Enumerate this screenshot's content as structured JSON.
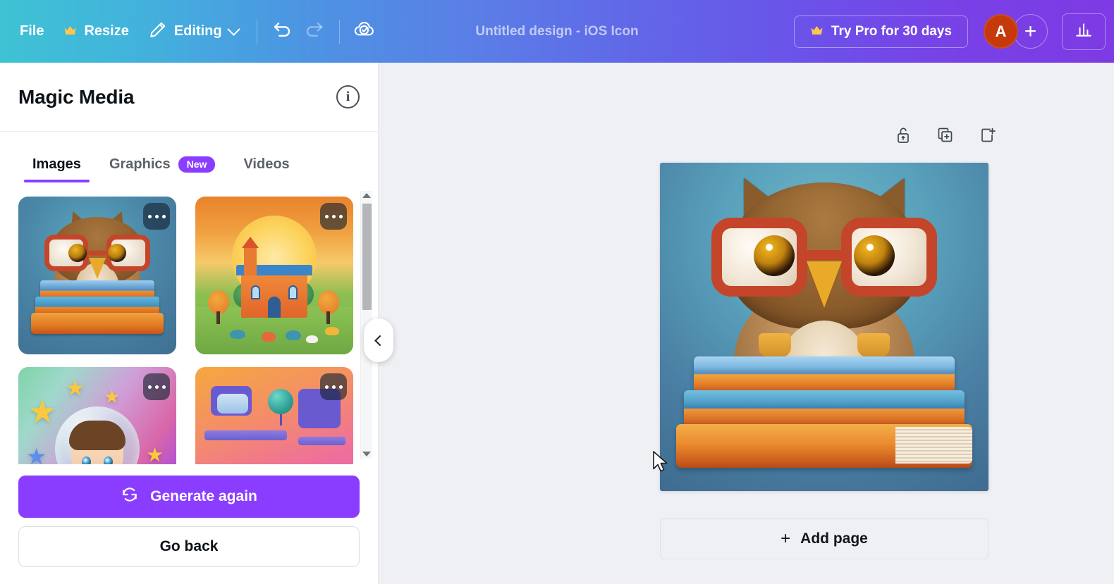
{
  "topbar": {
    "file_label": "File",
    "resize_label": "Resize",
    "editing_label": "Editing",
    "undo_icon": "undo-arrow-icon",
    "redo_icon": "redo-arrow-icon",
    "save_status_icon": "cloud-check-icon",
    "design_title": "Untitled design - iOS Icon",
    "try_pro_label": "Try Pro for 30 days",
    "crown_glyph": "♕",
    "avatar_initial": "A",
    "plus_glyph": "+",
    "chart_icon": "bar-chart-icon",
    "gradient_start": "#3ec2d4",
    "gradient_end": "#7e3ae4"
  },
  "sidebar": {
    "panel_title": "Magic Media",
    "info_glyph": "i",
    "tabs": [
      {
        "label": "Images",
        "active": true,
        "badge": ""
      },
      {
        "label": "Graphics",
        "active": false,
        "badge": "New"
      },
      {
        "label": "Videos",
        "active": false,
        "badge": ""
      }
    ],
    "results": [
      {
        "alt": "Owl with red glasses sitting on a stack of books",
        "art": "owl"
      },
      {
        "alt": "Schoolhouse at sunrise with autumn trees and animals",
        "art": "school"
      },
      {
        "alt": "Smiling child inside a bubble surrounded by stars",
        "art": "bubble"
      },
      {
        "alt": "Cartoon room with shelves, globe and a cat",
        "art": "room"
      }
    ],
    "more_options_label": "More options",
    "generate_again_label": "Generate again",
    "generate_icon": "refresh-icon",
    "go_back_label": "Go back",
    "collapse_icon": "chevron-left-icon",
    "accent_color": "#8b3dff"
  },
  "canvas": {
    "page_tools": [
      {
        "icon": "unlock-icon",
        "label": "Unlock"
      },
      {
        "icon": "duplicate-page-icon",
        "label": "Duplicate page"
      },
      {
        "icon": "add-page-icon",
        "label": "Add page"
      }
    ],
    "page_alt": "Owl with red glasses sitting on a stack of books",
    "add_page_label": "Add page",
    "add_page_plus": "+",
    "background_color": "#eff0f4"
  }
}
